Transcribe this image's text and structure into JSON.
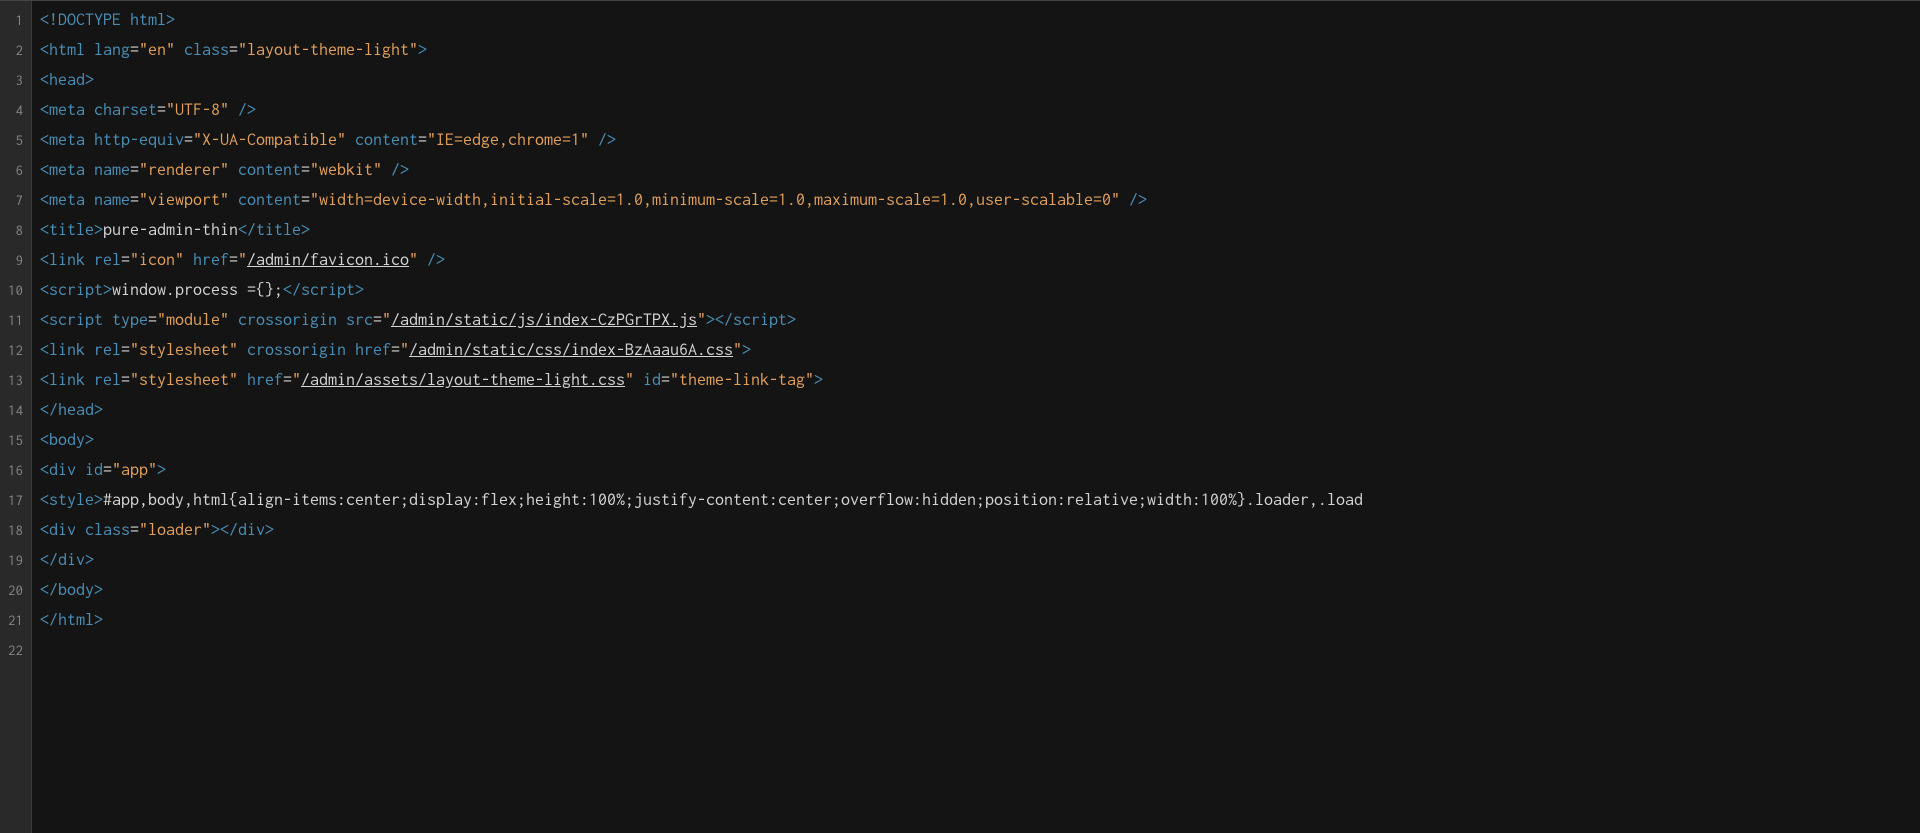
{
  "lines": [
    {
      "n": 1,
      "tokens": [
        {
          "c": "t-bracket",
          "t": "<!"
        },
        {
          "c": "t-tag",
          "t": "DOCTYPE"
        },
        {
          "c": "t-plain",
          "t": " "
        },
        {
          "c": "t-attr",
          "t": "html"
        },
        {
          "c": "t-bracket",
          "t": ">"
        }
      ]
    },
    {
      "n": 2,
      "tokens": [
        {
          "c": "t-bracket",
          "t": "<"
        },
        {
          "c": "t-tag",
          "t": "html"
        },
        {
          "c": "t-plain",
          "t": " "
        },
        {
          "c": "t-attr",
          "t": "lang"
        },
        {
          "c": "t-eq",
          "t": "="
        },
        {
          "c": "t-str",
          "t": "\"en\""
        },
        {
          "c": "t-plain",
          "t": " "
        },
        {
          "c": "t-attr",
          "t": "class"
        },
        {
          "c": "t-eq",
          "t": "="
        },
        {
          "c": "t-str",
          "t": "\"layout-theme-light\""
        },
        {
          "c": "t-bracket",
          "t": ">"
        }
      ]
    },
    {
      "n": 3,
      "tokens": [
        {
          "c": "t-bracket",
          "t": "<"
        },
        {
          "c": "t-tag",
          "t": "head"
        },
        {
          "c": "t-bracket",
          "t": ">"
        }
      ]
    },
    {
      "n": 4,
      "tokens": [
        {
          "c": "t-bracket",
          "t": "<"
        },
        {
          "c": "t-tag",
          "t": "meta"
        },
        {
          "c": "t-plain",
          "t": " "
        },
        {
          "c": "t-attr",
          "t": "charset"
        },
        {
          "c": "t-eq",
          "t": "="
        },
        {
          "c": "t-str",
          "t": "\"UTF-8\""
        },
        {
          "c": "t-plain",
          "t": " "
        },
        {
          "c": "t-bracket",
          "t": "/>"
        }
      ]
    },
    {
      "n": 5,
      "tokens": [
        {
          "c": "t-bracket",
          "t": "<"
        },
        {
          "c": "t-tag",
          "t": "meta"
        },
        {
          "c": "t-plain",
          "t": " "
        },
        {
          "c": "t-attr",
          "t": "http-equiv"
        },
        {
          "c": "t-eq",
          "t": "="
        },
        {
          "c": "t-str",
          "t": "\"X-UA-Compatible\""
        },
        {
          "c": "t-plain",
          "t": " "
        },
        {
          "c": "t-attr",
          "t": "content"
        },
        {
          "c": "t-eq",
          "t": "="
        },
        {
          "c": "t-str",
          "t": "\"IE=edge,chrome=1\""
        },
        {
          "c": "t-plain",
          "t": " "
        },
        {
          "c": "t-bracket",
          "t": "/>"
        }
      ]
    },
    {
      "n": 6,
      "tokens": [
        {
          "c": "t-bracket",
          "t": "<"
        },
        {
          "c": "t-tag",
          "t": "meta"
        },
        {
          "c": "t-plain",
          "t": " "
        },
        {
          "c": "t-attr",
          "t": "name"
        },
        {
          "c": "t-eq",
          "t": "="
        },
        {
          "c": "t-str",
          "t": "\"renderer\""
        },
        {
          "c": "t-plain",
          "t": " "
        },
        {
          "c": "t-attr",
          "t": "content"
        },
        {
          "c": "t-eq",
          "t": "="
        },
        {
          "c": "t-str",
          "t": "\"webkit\""
        },
        {
          "c": "t-plain",
          "t": " "
        },
        {
          "c": "t-bracket",
          "t": "/>"
        }
      ]
    },
    {
      "n": 7,
      "tokens": [
        {
          "c": "t-bracket",
          "t": "<"
        },
        {
          "c": "t-tag",
          "t": "meta"
        },
        {
          "c": "t-plain",
          "t": " "
        },
        {
          "c": "t-attr",
          "t": "name"
        },
        {
          "c": "t-eq",
          "t": "="
        },
        {
          "c": "t-str",
          "t": "\"viewport\""
        },
        {
          "c": "t-plain",
          "t": " "
        },
        {
          "c": "t-attr",
          "t": "content"
        },
        {
          "c": "t-eq",
          "t": "="
        },
        {
          "c": "t-str",
          "t": "\"width=device-width,initial-scale=1.0,minimum-scale=1.0,maximum-scale=1.0,user-scalable=0\""
        },
        {
          "c": "t-plain",
          "t": " "
        },
        {
          "c": "t-bracket",
          "t": "/>"
        }
      ]
    },
    {
      "n": 8,
      "tokens": [
        {
          "c": "t-bracket",
          "t": "<"
        },
        {
          "c": "t-tag",
          "t": "title"
        },
        {
          "c": "t-bracket",
          "t": ">"
        },
        {
          "c": "t-plain",
          "t": "pure-admin-thin"
        },
        {
          "c": "t-bracket",
          "t": "</"
        },
        {
          "c": "t-tag",
          "t": "title"
        },
        {
          "c": "t-bracket",
          "t": ">"
        }
      ]
    },
    {
      "n": 9,
      "tokens": [
        {
          "c": "t-bracket",
          "t": "<"
        },
        {
          "c": "t-tag",
          "t": "link"
        },
        {
          "c": "t-plain",
          "t": " "
        },
        {
          "c": "t-attr",
          "t": "rel"
        },
        {
          "c": "t-eq",
          "t": "="
        },
        {
          "c": "t-str",
          "t": "\"icon\""
        },
        {
          "c": "t-plain",
          "t": " "
        },
        {
          "c": "t-attr",
          "t": "href"
        },
        {
          "c": "t-eq",
          "t": "="
        },
        {
          "c": "t-str",
          "t": "\""
        },
        {
          "c": "t-link",
          "t": "/admin/favicon.ico"
        },
        {
          "c": "t-str",
          "t": "\""
        },
        {
          "c": "t-plain",
          "t": " "
        },
        {
          "c": "t-bracket",
          "t": "/>"
        }
      ]
    },
    {
      "n": 10,
      "tokens": [
        {
          "c": "t-bracket",
          "t": "<"
        },
        {
          "c": "t-tag",
          "t": "script"
        },
        {
          "c": "t-bracket",
          "t": ">"
        },
        {
          "c": "t-plain",
          "t": "window.process ={};"
        },
        {
          "c": "t-bracket",
          "t": "</"
        },
        {
          "c": "t-tag",
          "t": "script"
        },
        {
          "c": "t-bracket",
          "t": ">"
        }
      ]
    },
    {
      "n": 11,
      "tokens": [
        {
          "c": "t-bracket",
          "t": "<"
        },
        {
          "c": "t-tag",
          "t": "script"
        },
        {
          "c": "t-plain",
          "t": " "
        },
        {
          "c": "t-attr",
          "t": "type"
        },
        {
          "c": "t-eq",
          "t": "="
        },
        {
          "c": "t-str",
          "t": "\"module\""
        },
        {
          "c": "t-plain",
          "t": " "
        },
        {
          "c": "t-attr",
          "t": "crossorigin"
        },
        {
          "c": "t-plain",
          "t": " "
        },
        {
          "c": "t-attr",
          "t": "src"
        },
        {
          "c": "t-eq",
          "t": "="
        },
        {
          "c": "t-str",
          "t": "\""
        },
        {
          "c": "t-link",
          "t": "/admin/static/js/index-CzPGrTPX.js"
        },
        {
          "c": "t-str",
          "t": "\""
        },
        {
          "c": "t-bracket",
          "t": "></"
        },
        {
          "c": "t-tag",
          "t": "script"
        },
        {
          "c": "t-bracket",
          "t": ">"
        }
      ]
    },
    {
      "n": 12,
      "tokens": [
        {
          "c": "t-bracket",
          "t": "<"
        },
        {
          "c": "t-tag",
          "t": "link"
        },
        {
          "c": "t-plain",
          "t": " "
        },
        {
          "c": "t-attr",
          "t": "rel"
        },
        {
          "c": "t-eq",
          "t": "="
        },
        {
          "c": "t-str",
          "t": "\"stylesheet\""
        },
        {
          "c": "t-plain",
          "t": " "
        },
        {
          "c": "t-attr",
          "t": "crossorigin"
        },
        {
          "c": "t-plain",
          "t": " "
        },
        {
          "c": "t-attr",
          "t": "href"
        },
        {
          "c": "t-eq",
          "t": "="
        },
        {
          "c": "t-str",
          "t": "\""
        },
        {
          "c": "t-link",
          "t": "/admin/static/css/index-BzAaau6A.css"
        },
        {
          "c": "t-str",
          "t": "\""
        },
        {
          "c": "t-bracket",
          "t": ">"
        }
      ]
    },
    {
      "n": 13,
      "tokens": [
        {
          "c": "t-bracket",
          "t": "<"
        },
        {
          "c": "t-tag",
          "t": "link"
        },
        {
          "c": "t-plain",
          "t": " "
        },
        {
          "c": "t-attr",
          "t": "rel"
        },
        {
          "c": "t-eq",
          "t": "="
        },
        {
          "c": "t-str",
          "t": "\"stylesheet\""
        },
        {
          "c": "t-plain",
          "t": " "
        },
        {
          "c": "t-attr",
          "t": "href"
        },
        {
          "c": "t-eq",
          "t": "="
        },
        {
          "c": "t-str",
          "t": "\""
        },
        {
          "c": "t-link",
          "t": "/admin/assets/layout-theme-light.css"
        },
        {
          "c": "t-str",
          "t": "\""
        },
        {
          "c": "t-plain",
          "t": " "
        },
        {
          "c": "t-attr",
          "t": "id"
        },
        {
          "c": "t-eq",
          "t": "="
        },
        {
          "c": "t-str",
          "t": "\"theme-link-tag\""
        },
        {
          "c": "t-bracket",
          "t": ">"
        }
      ]
    },
    {
      "n": 14,
      "tokens": [
        {
          "c": "t-bracket",
          "t": "</"
        },
        {
          "c": "t-tag",
          "t": "head"
        },
        {
          "c": "t-bracket",
          "t": ">"
        }
      ]
    },
    {
      "n": 15,
      "tokens": [
        {
          "c": "t-bracket",
          "t": "<"
        },
        {
          "c": "t-tag",
          "t": "body"
        },
        {
          "c": "t-bracket",
          "t": ">"
        }
      ]
    },
    {
      "n": 16,
      "tokens": [
        {
          "c": "t-bracket",
          "t": "<"
        },
        {
          "c": "t-tag",
          "t": "div"
        },
        {
          "c": "t-plain",
          "t": " "
        },
        {
          "c": "t-attr",
          "t": "id"
        },
        {
          "c": "t-eq",
          "t": "="
        },
        {
          "c": "t-str",
          "t": "\"app\""
        },
        {
          "c": "t-bracket",
          "t": ">"
        }
      ]
    },
    {
      "n": 17,
      "tokens": [
        {
          "c": "t-bracket",
          "t": "<"
        },
        {
          "c": "t-tag",
          "t": "style"
        },
        {
          "c": "t-bracket",
          "t": ">"
        },
        {
          "c": "t-plain",
          "t": "#app,body,html{align-items:center;display:flex;height:100%;justify-content:center;overflow:hidden;position:relative;width:100%}.loader,.load"
        }
      ]
    },
    {
      "n": 18,
      "tokens": [
        {
          "c": "t-bracket",
          "t": "<"
        },
        {
          "c": "t-tag",
          "t": "div"
        },
        {
          "c": "t-plain",
          "t": " "
        },
        {
          "c": "t-attr",
          "t": "class"
        },
        {
          "c": "t-eq",
          "t": "="
        },
        {
          "c": "t-str",
          "t": "\"loader\""
        },
        {
          "c": "t-bracket",
          "t": "></"
        },
        {
          "c": "t-tag",
          "t": "div"
        },
        {
          "c": "t-bracket",
          "t": ">"
        }
      ]
    },
    {
      "n": 19,
      "tokens": [
        {
          "c": "t-bracket",
          "t": "</"
        },
        {
          "c": "t-tag",
          "t": "div"
        },
        {
          "c": "t-bracket",
          "t": ">"
        }
      ]
    },
    {
      "n": 20,
      "tokens": [
        {
          "c": "t-bracket",
          "t": "</"
        },
        {
          "c": "t-tag",
          "t": "body"
        },
        {
          "c": "t-bracket",
          "t": ">"
        }
      ]
    },
    {
      "n": 21,
      "tokens": [
        {
          "c": "t-bracket",
          "t": "</"
        },
        {
          "c": "t-tag",
          "t": "html"
        },
        {
          "c": "t-bracket",
          "t": ">"
        }
      ]
    },
    {
      "n": 22,
      "tokens": []
    }
  ]
}
